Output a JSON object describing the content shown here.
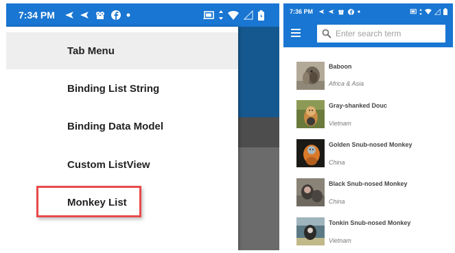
{
  "left_screen": {
    "status_bar": {
      "time": "7:34 PM",
      "notification_icons": [
        "send-icon",
        "send-icon",
        "mascot-icon",
        "facebook-icon",
        "dot-icon"
      ],
      "system_icons": [
        "cast-icon",
        "data-arrows-icon",
        "wifi-icon",
        "no-signal-icon",
        "battery-icon"
      ]
    },
    "drawer": {
      "items": [
        {
          "label": "Tab Menu",
          "selected": true
        },
        {
          "label": "Binding List String",
          "selected": false
        },
        {
          "label": "Binding Data Model",
          "selected": false
        },
        {
          "label": "Custom ListView",
          "selected": false
        },
        {
          "label": "Monkey List",
          "selected": false,
          "highlighted": true
        }
      ]
    },
    "colors": {
      "status_bar": "#1976d2",
      "highlight": "#e8494a",
      "app_header": "#15588f"
    }
  },
  "right_screen": {
    "status_bar": {
      "time": "7:36 PM",
      "notification_icons": [
        "send-icon",
        "send-icon",
        "mascot-icon",
        "facebook-icon",
        "dot-icon"
      ],
      "system_icons": [
        "cast-icon",
        "data-arrows-icon",
        "wifi-icon",
        "no-signal-icon",
        "battery-icon"
      ]
    },
    "toolbar": {
      "menu_icon": "hamburger-icon",
      "search_icon": "search-icon",
      "search_placeholder": "Enter search term"
    },
    "monkeys": [
      {
        "name": "Baboon",
        "location": "Africa & Asia"
      },
      {
        "name": "Gray-shanked Douc",
        "location": "Vietnam"
      },
      {
        "name": "Golden Snub-nosed Monkey",
        "location": "China"
      },
      {
        "name": "Black Snub-nosed Monkey",
        "location": "China"
      },
      {
        "name": "Tonkin Snub-nosed Monkey",
        "location": "Vietnam"
      }
    ]
  }
}
